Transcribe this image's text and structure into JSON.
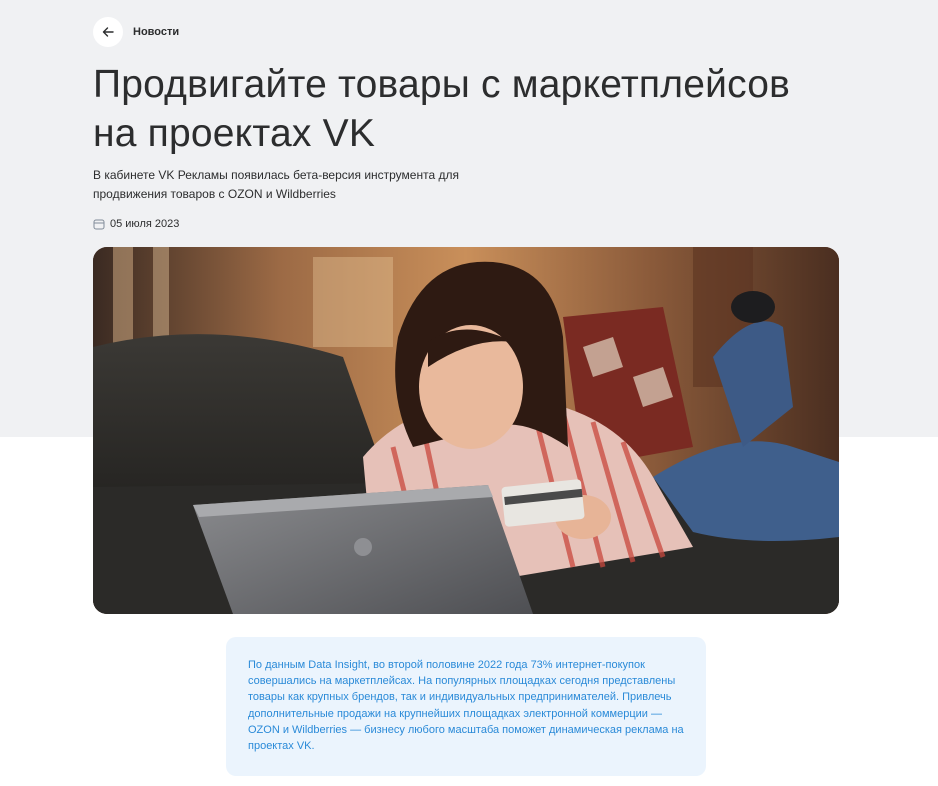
{
  "nav": {
    "back_label": "Новости",
    "back_icon": "arrow-left-icon"
  },
  "article": {
    "title": "Продвигайте товары с маркетплейсов на проектах VK",
    "subtitle": "В кабинете VK Рекламы появилась бета-версия инструмента для продвижения товаров с OZON и Wildberries",
    "date": "05 июля 2023",
    "date_icon": "calendar-icon",
    "lead": "По данным Data Insight, во второй половине 2022 года 73% интернет-покупок совершались на маркетплейсах. На популярных площадках сегодня представлены товары как крупных брендов, так и индивидуальных предпринимателей. Привлечь дополнительные продажи на крупнейших площадках электронной коммерции — OZON и Wildberries — бизнесу любого масштаба поможет динамическая реклама на проектах VK."
  },
  "colors": {
    "hero_background": "#f0f1f3",
    "text": "#2c2d2e",
    "lead_background": "#ebf4fd",
    "lead_text": "#2a8ad8"
  }
}
